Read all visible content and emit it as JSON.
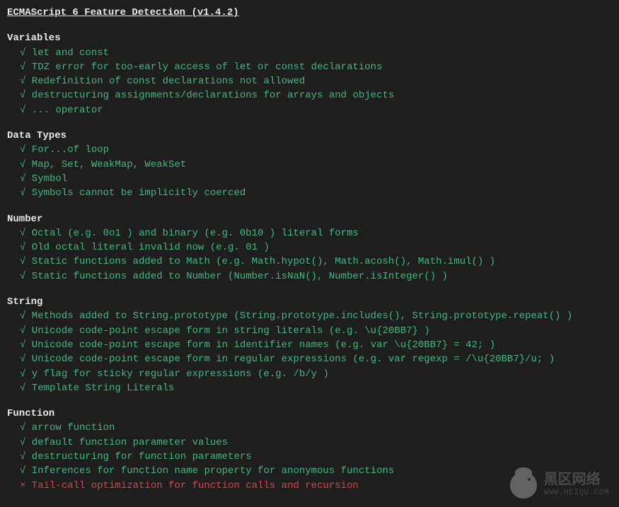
{
  "title": "ECMAScript 6 Feature Detection (v1.4.2)",
  "sections": [
    {
      "header": "Variables",
      "items": [
        {
          "status": "pass",
          "text": "let and const"
        },
        {
          "status": "pass",
          "text": "TDZ error for too-early access of let or const declarations"
        },
        {
          "status": "pass",
          "text": "Redefinition of const declarations not allowed"
        },
        {
          "status": "pass",
          "text": "destructuring assignments/declarations for arrays and objects"
        },
        {
          "status": "pass",
          "text": "... operator"
        }
      ]
    },
    {
      "header": "Data Types",
      "items": [
        {
          "status": "pass",
          "text": "For...of loop"
        },
        {
          "status": "pass",
          "text": "Map, Set, WeakMap, WeakSet"
        },
        {
          "status": "pass",
          "text": "Symbol"
        },
        {
          "status": "pass",
          "text": "Symbols cannot be implicitly coerced"
        }
      ]
    },
    {
      "header": "Number",
      "items": [
        {
          "status": "pass",
          "text": "Octal (e.g. 0o1 ) and binary (e.g. 0b10 ) literal forms"
        },
        {
          "status": "pass",
          "text": "Old octal literal invalid now (e.g. 01 )"
        },
        {
          "status": "pass",
          "text": "Static functions added to Math (e.g. Math.hypot(), Math.acosh(), Math.imul() )"
        },
        {
          "status": "pass",
          "text": "Static functions added to Number (Number.isNaN(), Number.isInteger() )"
        }
      ]
    },
    {
      "header": "String",
      "items": [
        {
          "status": "pass",
          "text": "Methods added to String.prototype (String.prototype.includes(), String.prototype.repeat() )"
        },
        {
          "status": "pass",
          "text": "Unicode code-point escape form in string literals (e.g. \\u{20BB7} )"
        },
        {
          "status": "pass",
          "text": "Unicode code-point escape form in identifier names (e.g. var \\u{20BB7} = 42; )"
        },
        {
          "status": "pass",
          "text": "Unicode code-point escape form in regular expressions (e.g. var regexp = /\\u{20BB7}/u; )"
        },
        {
          "status": "pass",
          "text": "y flag for sticky regular expressions (e.g. /b/y )"
        },
        {
          "status": "pass",
          "text": "Template String Literals"
        }
      ]
    },
    {
      "header": "Function",
      "items": [
        {
          "status": "pass",
          "text": "arrow function"
        },
        {
          "status": "pass",
          "text": "default function parameter values"
        },
        {
          "status": "pass",
          "text": "destructuring for function parameters"
        },
        {
          "status": "pass",
          "text": "Inferences for function name property for anonymous functions"
        },
        {
          "status": "fail",
          "text": "Tail-call optimization for function calls and recursion"
        }
      ]
    }
  ],
  "marks": {
    "pass": "√",
    "fail": "×"
  },
  "watermark": {
    "cn": "黑区网络",
    "en": "WWW.HEIQU.COM"
  }
}
